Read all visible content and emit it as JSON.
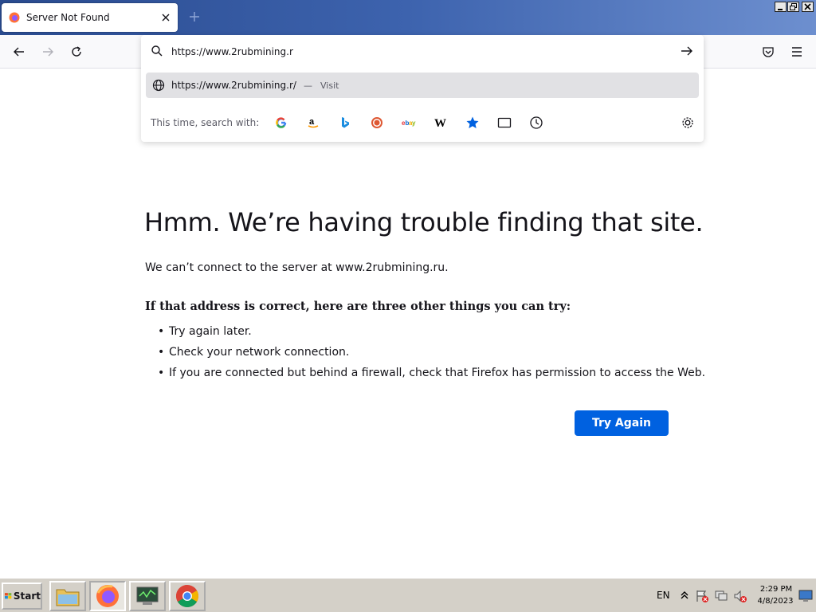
{
  "window": {
    "tab_title": "Server Not Found"
  },
  "urlbar": {
    "value": "https://www.2rubmining.r",
    "suggestion_url": "https://www.2rubmining.r/",
    "suggestion_sep": "—",
    "suggestion_action": "Visit",
    "search_with_label": "This time, search with:",
    "engines": [
      "google-icon",
      "amazon-icon",
      "bing-icon",
      "duckduckgo-icon",
      "ebay-icon",
      "wikipedia-icon",
      "bookmarks-icon",
      "tabs-icon",
      "history-icon"
    ]
  },
  "error": {
    "title": "Hmm. We’re having trouble finding that site.",
    "description": "We can’t connect to the server at www.2rubmining.ru.",
    "try_heading": "If that address is correct, here are three other things you can try:",
    "suggestions": [
      "Try again later.",
      "Check your network connection.",
      "If you are connected but behind a firewall, check that Firefox has permission to access the Web."
    ],
    "button_label": "Try Again"
  },
  "taskbar": {
    "start_label": "Start",
    "language": "EN",
    "time": "2:29 PM",
    "date": "4/8/2023"
  },
  "colors": {
    "accent": "#0061e0",
    "title_bar": "#2a4b8f",
    "taskbar": "#d4d0c8"
  }
}
